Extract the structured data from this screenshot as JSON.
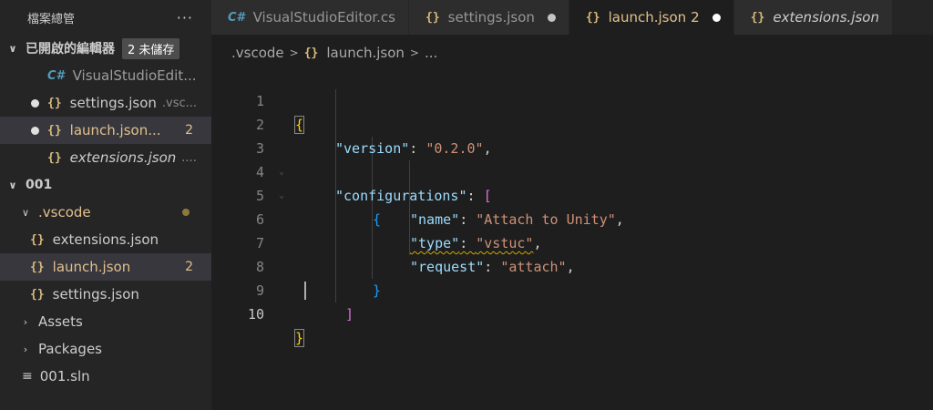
{
  "sidebar": {
    "title": "檔案總管",
    "more": "···",
    "open_editors": {
      "label": "已開啟的編輯器",
      "unsaved_badge": "2 未儲存",
      "items": [
        {
          "icon": "C#",
          "name": "VisualStudioEdit...",
          "desc": ""
        },
        {
          "icon": "{}",
          "name": "settings.json",
          "desc": ".vsc..."
        },
        {
          "icon": "{}",
          "name": "launch.json...",
          "desc": "",
          "count": "2"
        },
        {
          "icon": "{}",
          "name": "extensions.json",
          "desc": "...."
        }
      ]
    },
    "project": {
      "label": "001",
      "vscode_folder": ".vscode",
      "files": [
        {
          "icon": "{}",
          "name": "extensions.json"
        },
        {
          "icon": "{}",
          "name": "launch.json",
          "count": "2"
        },
        {
          "icon": "{}",
          "name": "settings.json"
        }
      ],
      "folders": [
        "Assets",
        "Packages"
      ],
      "sln": {
        "icon": "≡",
        "name": "001.sln"
      }
    }
  },
  "tabs": [
    {
      "icon": "C#",
      "label": "VisualStudioEditor.cs"
    },
    {
      "icon": "{}",
      "label": "settings.json"
    },
    {
      "icon": "{}",
      "label": "launch.json",
      "count": "2"
    },
    {
      "icon": "{}",
      "label": "extensions.json"
    }
  ],
  "breadcrumb": {
    "folder": ".vscode",
    "file_icon": "{}",
    "file": "launch.json",
    "more": "..."
  },
  "editor": {
    "line_numbers": [
      "1",
      "2",
      "3",
      "4",
      "5",
      "6",
      "7",
      "8",
      "9",
      "10"
    ],
    "brace_open": "{",
    "brace_close": "}",
    "bracket_open": "[",
    "bracket_close": "]",
    "version_key": "\"version\"",
    "version_val": "\"0.2.0\"",
    "configurations_key": "\"configurations\"",
    "name_key": "\"name\"",
    "name_val": "\"Attach to Unity\"",
    "type_key": "\"type\"",
    "type_val": "\"vstuc\"",
    "request_key": "\"request\"",
    "request_val": "\"attach\"",
    "colon": ": ",
    "comma": ","
  },
  "colors": {
    "background": "#1e1e1e",
    "sidebar": "#252526",
    "modified": "#e2c08d",
    "json_key": "#9cdcfe",
    "json_string": "#ce9178"
  }
}
